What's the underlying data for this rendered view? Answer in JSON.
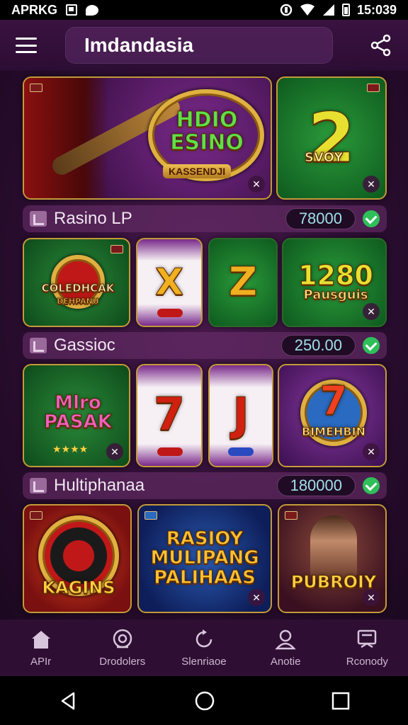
{
  "status_bar": {
    "left_text": "APRKG",
    "time": "15:039"
  },
  "search": {
    "value": "Imdandasia"
  },
  "featured": [
    {
      "title": "HDIO ESINO",
      "ribbon": "KASSENDJI"
    },
    {
      "title": "2",
      "subtitle": "SVOY"
    }
  ],
  "categories": [
    {
      "label": "Rasino LP",
      "value": "78000"
    },
    {
      "label": "Gassioc",
      "value": "250.00"
    },
    {
      "label": "Hultiphanaa",
      "value": "180000"
    }
  ],
  "row1": [
    {
      "title": "COLEDHCAK",
      "subtitle": "DEHPANU"
    },
    {
      "title": "X"
    },
    {
      "title": "Z"
    },
    {
      "title": "1280",
      "subtitle": "Pausguis"
    }
  ],
  "row2": [
    {
      "title": "Mlro PASAK"
    },
    {
      "title": "7"
    },
    {
      "title": "J"
    },
    {
      "title": "7",
      "subtitle": "BIMEHBIN"
    }
  ],
  "row3": [
    {
      "title": "KAGINS"
    },
    {
      "title": "RASIOY MULIPANG PALIHAAS"
    },
    {
      "title": "PUBROIY"
    }
  ],
  "bottom_nav": [
    {
      "label": "APIr",
      "icon": "home-icon"
    },
    {
      "label": "Drodolers",
      "icon": "target-icon"
    },
    {
      "label": "Slenriaoe",
      "icon": "refresh-icon"
    },
    {
      "label": "Anotie",
      "icon": "user-icon"
    },
    {
      "label": "Rconody",
      "icon": "wallet-icon"
    }
  ],
  "colors": {
    "accent": "#2fbf5a",
    "gold": "#e0b040",
    "background": "#2a0d30"
  }
}
